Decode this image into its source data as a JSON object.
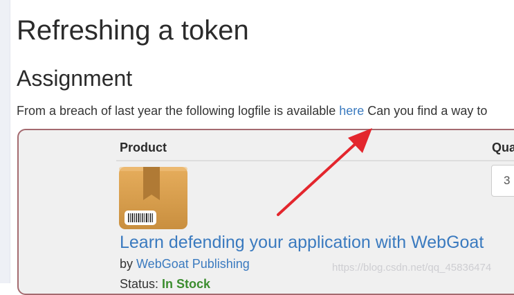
{
  "page": {
    "title": "Refreshing a token"
  },
  "assignment": {
    "heading": "Assignment",
    "text_before_link": "From a breach of last year the following logfile is available ",
    "link_label": "here",
    "text_after_link": " Can you find a way to"
  },
  "cart_table": {
    "headers": {
      "product": "Product",
      "quantity": "Qua"
    },
    "rows": [
      {
        "image_icon": "package-box-icon",
        "product_name": "Learn defending your application with WebGoat",
        "by_label": "by ",
        "publisher": "WebGoat Publishing",
        "status_label": "Status: ",
        "status_value": "In Stock",
        "quantity": "3"
      }
    ]
  },
  "annotation": {
    "arrow_color": "#e3262d"
  },
  "colors": {
    "link": "#3a7abf",
    "container_border": "#a46a6f",
    "in_stock": "#3c8d2f"
  },
  "watermark": "https://blog.csdn.net/qq_45836474"
}
